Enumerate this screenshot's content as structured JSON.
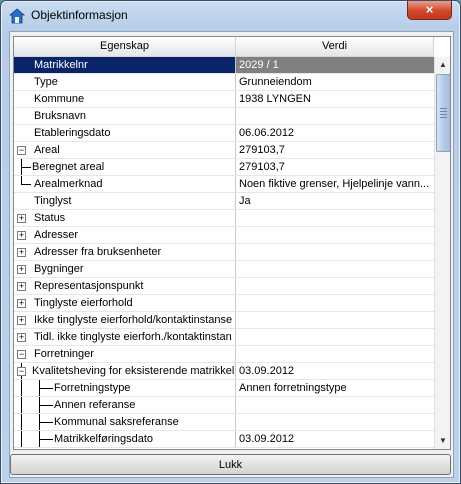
{
  "window": {
    "title": "Objektinformasjon",
    "close_glyph": "×"
  },
  "grid": {
    "columns": [
      "Egenskap",
      "Verdi"
    ],
    "rows": [
      {
        "label": "Matrikkelnr",
        "value": "2029 / 1"
      },
      {
        "label": "Type",
        "value": "Grunneiendom"
      },
      {
        "label": "Kommune",
        "value": "1938  LYNGEN"
      },
      {
        "label": "Bruksnavn",
        "value": ""
      },
      {
        "label": "Etableringsdato",
        "value": "06.06.2012"
      },
      {
        "label": "Areal",
        "value": "279103,7"
      },
      {
        "label": "Beregnet areal",
        "value": "279103,7"
      },
      {
        "label": "Arealmerknad",
        "value": "Noen fiktive grenser, Hjelpelinje vann..."
      },
      {
        "label": "Tinglyst",
        "value": "Ja"
      },
      {
        "label": "Status",
        "value": ""
      },
      {
        "label": "Adresser",
        "value": ""
      },
      {
        "label": "Adresser fra bruksenheter",
        "value": ""
      },
      {
        "label": "Bygninger",
        "value": ""
      },
      {
        "label": "Representasjonspunkt",
        "value": ""
      },
      {
        "label": "Tinglyste eierforhold",
        "value": ""
      },
      {
        "label": "Ikke tinglyste eierforhold/kontaktinstanse",
        "value": ""
      },
      {
        "label": "Tidl. ikke tinglyste eierforh./kontaktinstan",
        "value": ""
      },
      {
        "label": "Forretninger",
        "value": ""
      },
      {
        "label": "Kvalitetsheving for eksisterende matrikkel",
        "value": "03.09.2012"
      },
      {
        "label": "Forretningstype",
        "value": "Annen forretningstype"
      },
      {
        "label": "Annen referanse",
        "value": ""
      },
      {
        "label": "Kommunal saksreferanse",
        "value": ""
      },
      {
        "label": "Matrikkelføringsdato",
        "value": "03.09.2012"
      }
    ]
  },
  "footer": {
    "close_label": "Lukk"
  },
  "icons": {
    "app": "house-icon",
    "collapse": "minus-icon",
    "expand": "plus-icon"
  }
}
